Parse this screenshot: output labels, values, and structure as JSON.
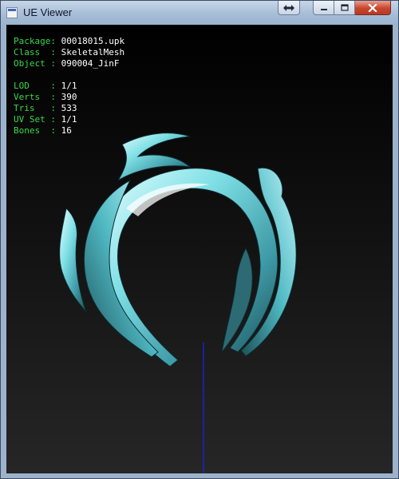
{
  "window": {
    "title": "UE Viewer"
  },
  "icons": {
    "app": "ue-viewer-icon",
    "back": "switch-arrows-icon",
    "minimize": "minimize-icon",
    "maximize": "maximize-icon",
    "close": "close-icon"
  },
  "info": {
    "object": [
      {
        "key": "Package: ",
        "value": "00018015.upk"
      },
      {
        "key": "Class  : ",
        "value": "SkeletalMesh"
      },
      {
        "key": "Object : ",
        "value": "090004_JinF"
      }
    ],
    "stats": [
      {
        "key": "LOD    : ",
        "value": "1/1"
      },
      {
        "key": "Verts  : ",
        "value": "390"
      },
      {
        "key": "Tris   : ",
        "value": "533"
      },
      {
        "key": "UV Set : ",
        "value": "1/1"
      },
      {
        "key": "Bones  : ",
        "value": "16"
      }
    ]
  },
  "colors": {
    "label": "#39d84a",
    "value": "#ffffff",
    "mesh": "#6fd6de",
    "axis": "#1a22c8"
  }
}
